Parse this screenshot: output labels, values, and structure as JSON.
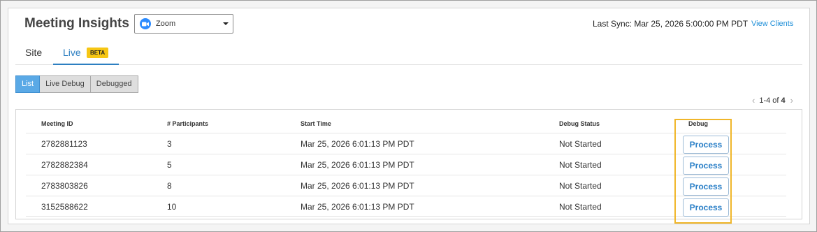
{
  "header": {
    "title": "Meeting Insights",
    "integration_select": {
      "selected": "Zoom",
      "icon": "zoom-icon"
    },
    "last_sync": "Last Sync: Mar 25, 2026 5:00:00 PM PDT",
    "view_clients": "View Clients"
  },
  "tabs": [
    {
      "label": "Site",
      "active": false
    },
    {
      "label": "Live",
      "active": true,
      "badge": "BETA"
    }
  ],
  "view_toggle": [
    {
      "label": "List",
      "active": true
    },
    {
      "label": "Live Debug",
      "active": false
    },
    {
      "label": "Debugged",
      "active": false
    }
  ],
  "pagination": {
    "range": "1-4 of",
    "total": "4"
  },
  "table": {
    "columns": [
      "Meeting ID",
      "# Participants",
      "Start Time",
      "Debug Status",
      "Debug"
    ],
    "rows": [
      {
        "meeting_id": "2782881123",
        "participants": "3",
        "start_time": "Mar 25, 2026 6:01:13 PM PDT",
        "status": "Not Started",
        "action": "Process"
      },
      {
        "meeting_id": "2782882384",
        "participants": "5",
        "start_time": "Mar 25, 2026 6:01:13 PM PDT",
        "status": "Not Started",
        "action": "Process"
      },
      {
        "meeting_id": "2783803826",
        "participants": "8",
        "start_time": "Mar 25, 2026 6:01:13 PM PDT",
        "status": "Not Started",
        "action": "Process"
      },
      {
        "meeting_id": "3152588622",
        "participants": "10",
        "start_time": "Mar 25, 2026 6:01:13 PM PDT",
        "status": "Not Started",
        "action": "Process"
      }
    ]
  },
  "colors": {
    "accent": "#2d7fc1",
    "highlight": "#f0b62a",
    "beta_badge": "#f6c614",
    "active_toggle": "#5aa9e6"
  }
}
